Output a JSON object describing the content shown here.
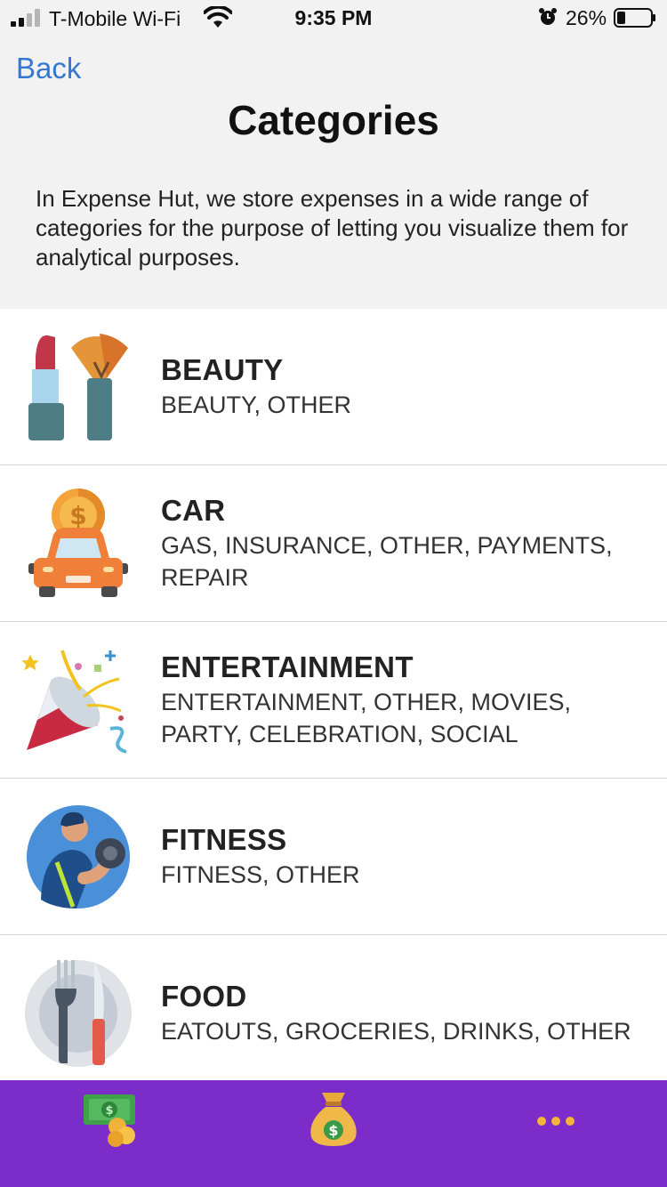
{
  "status_bar": {
    "carrier": "T-Mobile Wi-Fi",
    "time": "9:35 PM",
    "battery": "26%",
    "icons": [
      "signal-icon",
      "wifi-icon",
      "alarm-icon",
      "battery-icon"
    ]
  },
  "nav": {
    "back_label": "Back",
    "title": "Categories"
  },
  "intro": "In Expense Hut, we store expenses in a wide range of categories for the purpose of letting you visualize them for analytical purposes.",
  "categories": [
    {
      "name": "BEAUTY",
      "subcategories": "BEAUTY, OTHER",
      "icon": "lipstick-brush-icon"
    },
    {
      "name": "CAR",
      "subcategories": "GAS, INSURANCE, OTHER, PAYMENTS, REPAIR",
      "icon": "car-coin-icon"
    },
    {
      "name": "ENTERTAINMENT",
      "subcategories": "ENTERTAINMENT, OTHER, MOVIES, PARTY, CELEBRATION, SOCIAL",
      "icon": "party-popper-icon"
    },
    {
      "name": "FITNESS",
      "subcategories": "FITNESS, OTHER",
      "icon": "dumbbell-athlete-icon"
    },
    {
      "name": "FOOD",
      "subcategories": "EATOUTS, GROCERIES, DRINKS, OTHER",
      "icon": "plate-fork-knife-icon"
    }
  ],
  "tab_bar": {
    "background": "#7b2cc9",
    "tabs": [
      "cash-icon",
      "money-bag-icon",
      "more-dots-icon"
    ]
  },
  "colors": {
    "accent_link": "#3478d4",
    "header_bg": "#f2f2f2",
    "list_bg": "#ffffff"
  }
}
